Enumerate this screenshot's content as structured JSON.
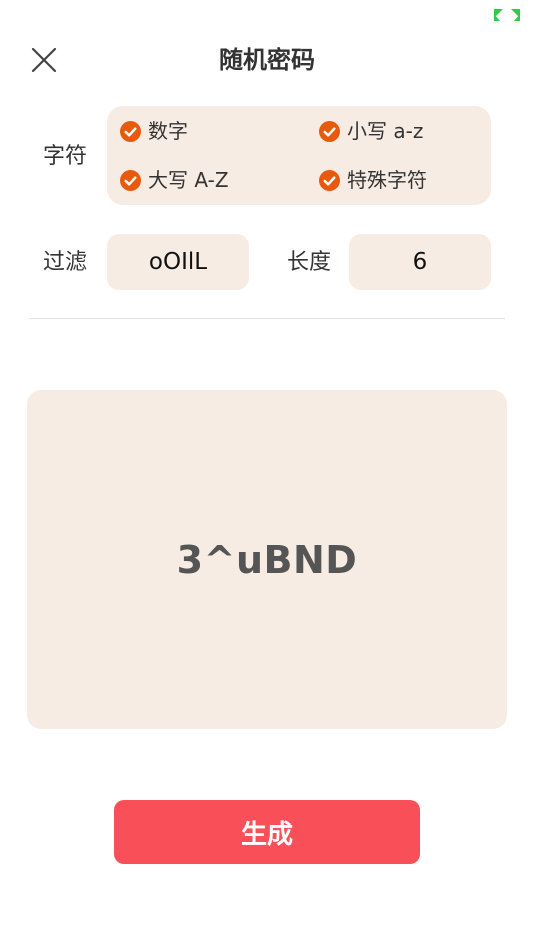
{
  "status_bar": {
    "indicator_icon": "expand-arrows-icon",
    "indicator_color": "#2ecc4a"
  },
  "header": {
    "title": "随机密码",
    "close_icon": "close-icon"
  },
  "characters": {
    "label": "字符",
    "options": [
      {
        "label": "数字",
        "checked": true
      },
      {
        "label": "小写 a-z",
        "checked": true
      },
      {
        "label": "大写 A-Z",
        "checked": true
      },
      {
        "label": "特殊字符",
        "checked": true
      }
    ],
    "check_icon": "check-circle-icon",
    "check_color": "#e8590c"
  },
  "filter": {
    "label": "过滤",
    "value": "oOIlL"
  },
  "length": {
    "label": "长度",
    "value": "6"
  },
  "result": {
    "password": "3^uBND"
  },
  "generate": {
    "label": "生成"
  },
  "colors": {
    "panel_bg": "#f7ece3",
    "button_bg": "#f94f59",
    "accent": "#e8590c"
  }
}
